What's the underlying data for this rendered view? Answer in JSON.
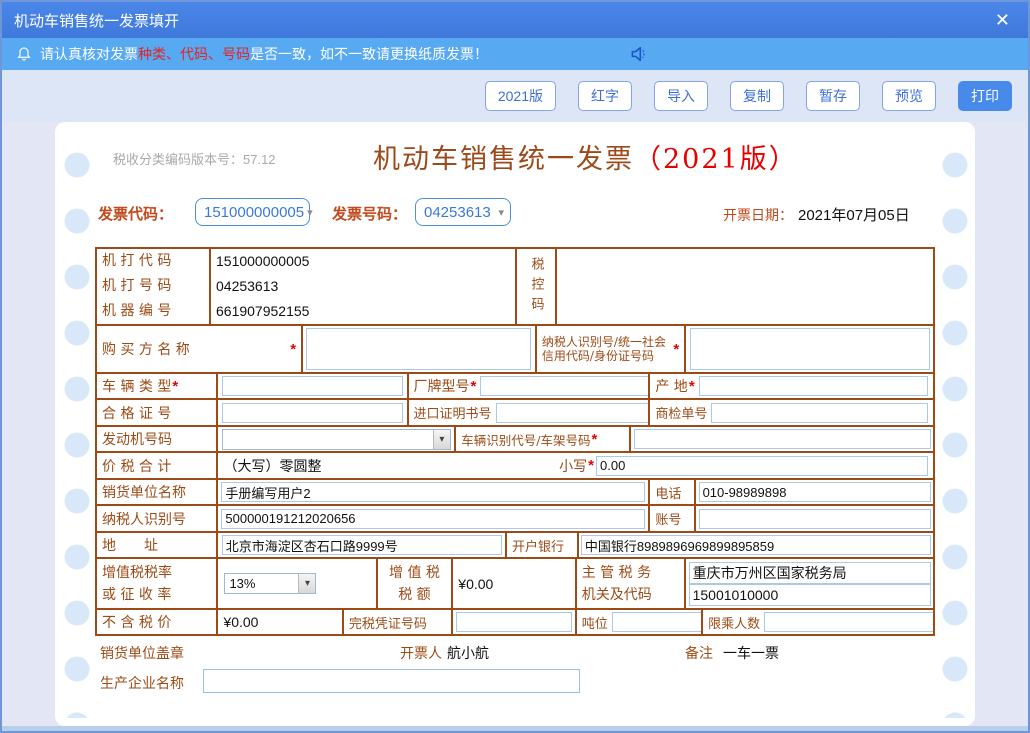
{
  "window": {
    "title": "机动车销售统一发票填开",
    "close_icon": "✕"
  },
  "notice": {
    "part1": "请认真核对发票",
    "highlight": "种类、代码、号码",
    "part2": "是否一致，如不一致请更换纸质发票！"
  },
  "toolbar": {
    "buttons": [
      {
        "label": "2021版"
      },
      {
        "label": "红字"
      },
      {
        "label": "导入"
      },
      {
        "label": "复制"
      },
      {
        "label": "暂存"
      },
      {
        "label": "预览"
      },
      {
        "label": "打印"
      }
    ]
  },
  "header": {
    "version_note": "税收分类编码版本号：57.12",
    "title_main": "机动车销售统一发票",
    "title_version": "（2021版）",
    "invoice_code_label": "发票代码：",
    "invoice_code": "151000000005",
    "invoice_number_label": "发票号码：",
    "invoice_number": "04253613",
    "date_label": "开票日期：",
    "date_value": "2021年07月05日"
  },
  "required_mark": "*",
  "icons": {
    "dropdown_arrow": "▾"
  },
  "table": {
    "machine_code_label": "机 打 代 码",
    "machine_code": "151000000005",
    "machine_number_label": "机 打 号 码",
    "machine_number": "04253613",
    "machine_id_label": "机 器 编 号",
    "machine_id": "661907952155",
    "tax_control_label": "税控码",
    "buyer_label": "购 买 方 名 称",
    "buyer_value": "",
    "buyer_taxid_label": "纳税人识别号/统一社会信用代码/身份证号码",
    "buyer_taxid_value": "",
    "vehicle_type_label": "车 辆 类 型",
    "vehicle_type_value": "",
    "brand_model_label": "厂牌型号",
    "brand_model_value": "",
    "origin_label": "产 地",
    "origin_value": "",
    "certificate_label": "合 格 证 号",
    "certificate_value": "",
    "import_cert_label": "进口证明书号",
    "import_cert_value": "",
    "inspection_label": "商检单号",
    "inspection_value": "",
    "engine_label": "发动机号码",
    "engine_value": "",
    "vin_label": "车辆识别代号/车架号码",
    "vin_value": "",
    "total_label": "价 税 合 计",
    "total_words": "（大写）零圆整",
    "total_small_label": "小写",
    "total_small_value": "0.00",
    "seller_label": "销货单位名称",
    "seller_value": "手册编写用户2",
    "phone_label": "电话",
    "phone_value": "010-98989898",
    "seller_taxno_label": "纳税人识别号",
    "seller_taxno_value": "500000191212020656",
    "account_label": "账号",
    "account_value": "",
    "address_label": "地　　址",
    "address_value": "北京市海淀区杏石口路9999号",
    "bank_label": "开户银行",
    "bank_value": "中国银行8989896969899895859",
    "vat_rate_label_1": "增值税税率",
    "vat_rate_label_2": "或 征 收 率",
    "vat_rate_value": "13%",
    "vat_amount_label_1": "增 值 税",
    "vat_amount_label_2": "税 额",
    "vat_amount_value": "¥0.00",
    "authority_label_1": "主 管 税 务",
    "authority_label_2": "机关及代码",
    "authority_value_1": "重庆市万州区国家税务局",
    "authority_value_2": "15001010000",
    "pretax_label": "不 含 税 价",
    "pretax_value": "¥0.00",
    "tax_paid_cert_label": "完税凭证号码",
    "tax_paid_cert_value": "",
    "tonnage_label": "吨位",
    "tonnage_value": "",
    "passenger_label": "限乘人数",
    "passenger_value": ""
  },
  "footer": {
    "stamp_label": "销货单位盖章",
    "drawer_label": "开票人",
    "drawer_value": "航小航",
    "remark_label": "备注",
    "remark_value": "一车一票",
    "manufacturer_label": "生产企业名称",
    "manufacturer_value": ""
  }
}
